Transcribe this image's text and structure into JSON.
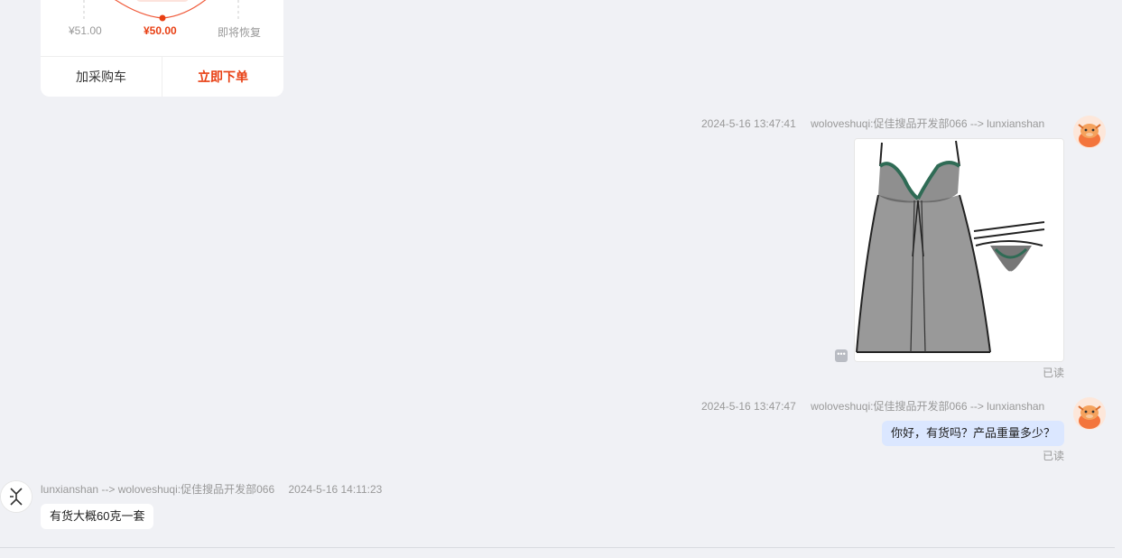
{
  "product_card": {
    "price_left": "¥51.00",
    "price_mid": "¥50.00",
    "price_right": "即将恢复",
    "add_cart_label": "加采购车",
    "order_now_label": "立即下单"
  },
  "messages": [
    {
      "direction": "outgoing",
      "time": "2024-5-16 13:47:41",
      "sender": "woloveshuqi:促佳搜品开发部066 --> lunxianshan",
      "type": "image",
      "image_desc_icon": "lingerie-product-image",
      "status": "已读"
    },
    {
      "direction": "outgoing",
      "time": "2024-5-16 13:47:47",
      "sender": "woloveshuqi:促佳搜品开发部066 --> lunxianshan",
      "type": "text",
      "text": "你好，有货吗？产品重量多少？",
      "status": "已读"
    },
    {
      "direction": "incoming",
      "time": "2024-5-16 14:11:23",
      "sender": "lunxianshan --> woloveshuqi:促佳搜品开发部066",
      "type": "text",
      "text": "有货大概60克一套"
    }
  ],
  "more_icon": "ellipsis-icon",
  "colors": {
    "accent": "#e83f13",
    "outgoing_bubble": "#dbe7ff",
    "background": "#f0f1f5"
  }
}
